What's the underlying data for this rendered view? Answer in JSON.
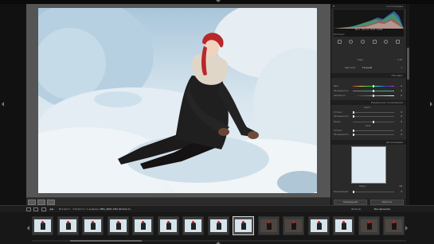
{
  "panels": {
    "histogram": {
      "header": "Гистограмма",
      "info_iso": "ISO 1",
      "info_focal": "85 mm",
      "info_aperture": "f/2.8",
      "info_shutter": "1/250",
      "original_label": "Оригинал"
    },
    "crop": {
      "label": "Кадр",
      "value": "0,00"
    },
    "presets": {
      "label": "Цветовой",
      "value": "Текущий"
    },
    "hsl": {
      "header": "Цвет",
      "header_prefix": "HSL",
      "rows": [
        {
          "label": "Цвет",
          "value": "0"
        },
        {
          "label": "Насыщенность",
          "value": "0"
        },
        {
          "label": "Светимость",
          "value": "0"
        }
      ]
    },
    "split_toning": {
      "header": "Раздельное тонирование",
      "highlights_label": "Света",
      "hue_label": "Оттенок",
      "sat_label": "Насыщенность",
      "balance_label": "Баланс",
      "shadows_label": "Тени",
      "highlights_hue": "0",
      "highlights_sat": "0",
      "balance": "0",
      "shadows_hue": "0",
      "shadows_sat": "0"
    },
    "detail": {
      "header": "Детализация",
      "amount_label": "Радиус",
      "amount_value": "1,0",
      "masking_label": "Маскирование",
      "masking_value": "0"
    },
    "bottom_buttons": {
      "previous": "Предыдущий",
      "reset": "Сбросить"
    }
  },
  "filmstrip_bar": {
    "nav_text": "Вся фото",
    "count_text": "130 фото / 1 выбрано /",
    "filename": "IMG_4661.CR2 (Копия 1)",
    "filter_label": "Фильтр:",
    "filter_value": "Без фильтра"
  },
  "filmstrip": {
    "thumbnails": [
      {
        "selected": false,
        "dark": false
      },
      {
        "selected": false,
        "dark": false
      },
      {
        "selected": false,
        "dark": false
      },
      {
        "selected": false,
        "dark": false
      },
      {
        "selected": false,
        "dark": false
      },
      {
        "selected": false,
        "dark": false
      },
      {
        "selected": false,
        "dark": false
      },
      {
        "selected": false,
        "dark": false
      },
      {
        "selected": true,
        "dark": false
      },
      {
        "selected": false,
        "dark": true
      },
      {
        "selected": false,
        "dark": true
      },
      {
        "selected": false,
        "dark": false
      },
      {
        "selected": false,
        "dark": false
      },
      {
        "selected": false,
        "dark": true
      },
      {
        "selected": false,
        "dark": true
      }
    ]
  },
  "colors": {
    "accent_hair": "#b8272b",
    "coat": "#1f1f1f",
    "snow": "#e8f0f5"
  }
}
